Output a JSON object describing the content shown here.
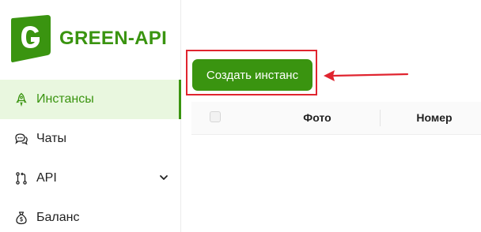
{
  "brand": {
    "name": "GREEN-API",
    "color": "#3a9410",
    "logo_icon": "green-api-g-logo-icon"
  },
  "sidebar": {
    "items": [
      {
        "label": "Инстансы",
        "icon": "rocket-icon",
        "active": true
      },
      {
        "label": "Чаты",
        "icon": "chat-bubbles-icon",
        "active": false
      },
      {
        "label": "API",
        "icon": "api-branch-icon",
        "active": false,
        "expandable": true
      },
      {
        "label": "Баланс",
        "icon": "money-bag-icon",
        "active": false
      }
    ]
  },
  "main": {
    "create_button_label": "Создать инстанс",
    "annotation_color": "#e0242f",
    "table": {
      "columns": [
        "Фото",
        "Номер"
      ]
    }
  }
}
